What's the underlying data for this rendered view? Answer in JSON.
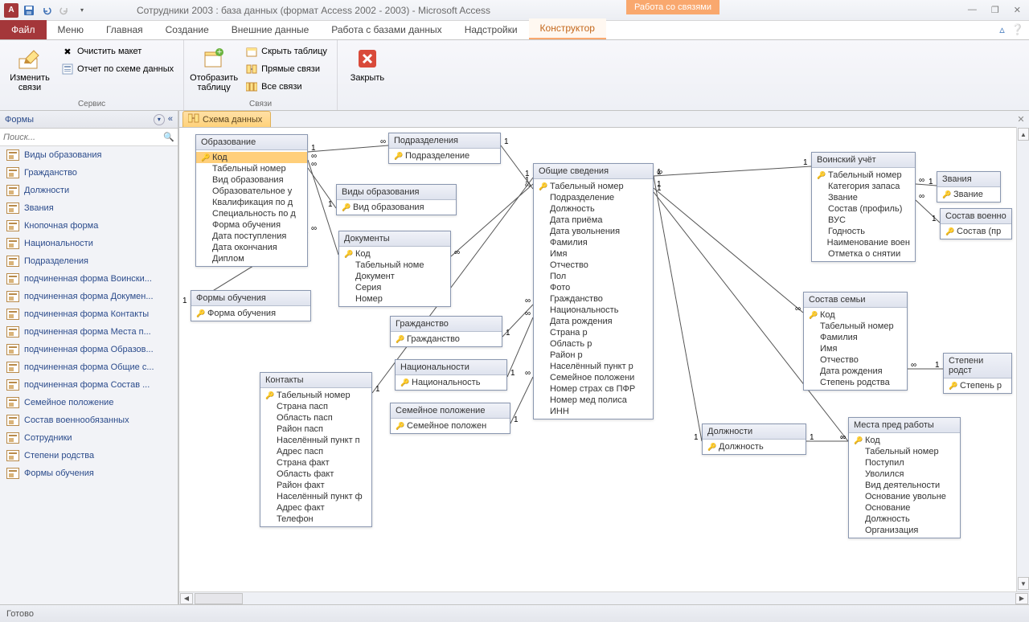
{
  "title": "Сотрудники 2003 : база данных (формат Access 2002 - 2003)  -  Microsoft Access",
  "context_tab_group": "Работа со связями",
  "ribbon_tabs": {
    "file": "Файл",
    "menu": "Меню",
    "home": "Главная",
    "create": "Создание",
    "external": "Внешние данные",
    "dbtools": "Работа с базами данных",
    "addins": "Надстройки",
    "design": "Конструктор"
  },
  "ribbon": {
    "edit_rel": "Изменить связи",
    "clear_layout": "Очистить макет",
    "rel_report": "Отчет по схеме данных",
    "group_service": "Сервис",
    "show_table": "Отобразить таблицу",
    "hide_table": "Скрыть таблицу",
    "direct_rel": "Прямые связи",
    "all_rel": "Все связи",
    "group_rel": "Связи",
    "close": "Закрыть"
  },
  "nav": {
    "header": "Формы",
    "search_placeholder": "Поиск...",
    "items": [
      "Виды образования",
      "Гражданство",
      "Должности",
      "Звания",
      "Кнопочная форма",
      "Национальности",
      "Подразделения",
      "подчиненная форма Воински...",
      "подчиненная форма Докумен...",
      "подчиненная форма Контакты",
      "подчиненная форма Места п...",
      "подчиненная форма Образов...",
      "подчиненная форма Общие с...",
      "подчиненная форма Состав ...",
      "Семейное положение",
      "Состав военнообязанных",
      "Сотрудники",
      "Степени родства",
      "Формы обучения"
    ]
  },
  "doc_tab": "Схема данных",
  "tables": {
    "education": {
      "title": "Образование",
      "fields": [
        "Код",
        "Табельный номер",
        "Вид образования",
        "Образовательное у",
        "Квалификация по д",
        "Специальность по д",
        "Форма обучения",
        "Дата поступления",
        "Дата окончания",
        "Диплом"
      ],
      "key": [
        0
      ]
    },
    "divisions": {
      "title": "Подразделения",
      "fields": [
        "Подразделение"
      ],
      "key": [
        0
      ]
    },
    "edu_types": {
      "title": "Виды образования",
      "fields": [
        "Вид образования"
      ],
      "key": [
        0
      ]
    },
    "documents": {
      "title": "Документы",
      "fields": [
        "Код",
        "Табельный номе",
        "Документ",
        "Серия",
        "Номер"
      ],
      "key": [
        0
      ]
    },
    "study_forms": {
      "title": "Формы обучения",
      "fields": [
        "Форма обучения"
      ],
      "key": [
        0
      ]
    },
    "citizenship": {
      "title": "Гражданство",
      "fields": [
        "Гражданство"
      ],
      "key": [
        0
      ]
    },
    "nationality": {
      "title": "Национальности",
      "fields": [
        "Национальность"
      ],
      "key": [
        0
      ]
    },
    "marital": {
      "title": "Семейное положение",
      "fields": [
        "Семейное положен"
      ],
      "key": [
        0
      ]
    },
    "contacts": {
      "title": "Контакты",
      "fields": [
        "Табельный номер",
        "Страна пасп",
        "Область пасп",
        "Район пасп",
        "Населённый пункт п",
        "Адрес пасп",
        "Страна факт",
        "Область факт",
        "Район факт",
        "Населённый пункт ф",
        "Адрес факт",
        "Телефон"
      ],
      "key": [
        0
      ]
    },
    "general": {
      "title": "Общие сведения",
      "fields": [
        "Табельный номер",
        "Подразделение",
        "Должность",
        "Дата приёма",
        "Дата увольнения",
        "Фамилия",
        "Имя",
        "Отчество",
        "Пол",
        "Фото",
        "Гражданство",
        "Национальность",
        "Дата рождения",
        "Страна р",
        "Область р",
        "Район р",
        "Населённый пункт р",
        "Семейное положени",
        "Номер страх св ПФР",
        "Номер мед полиса",
        "ИНН"
      ],
      "key": [
        0
      ]
    },
    "military": {
      "title": "Воинский учёт",
      "fields": [
        "Табельный номер",
        "Категория запаса",
        "Звание",
        "Состав (профиль)",
        "ВУС",
        "Годность",
        "Наименование воен",
        "Отметка о снятии"
      ],
      "key": [
        0
      ]
    },
    "ranks": {
      "title": "Звания",
      "fields": [
        "Звание"
      ],
      "key": [
        0
      ]
    },
    "mil_status": {
      "title": "Состав военно",
      "fields": [
        "Состав (пр"
      ],
      "key": [
        0
      ]
    },
    "positions": {
      "title": "Должности",
      "fields": [
        "Должность"
      ],
      "key": [
        0
      ]
    },
    "family": {
      "title": "Состав семьи",
      "fields": [
        "Код",
        "Табельный номер",
        "Фамилия",
        "Имя",
        "Отчество",
        "Дата рождения",
        "Степень родства"
      ],
      "key": [
        0
      ]
    },
    "kinship": {
      "title": "Степени родст",
      "fields": [
        "Степень р"
      ],
      "key": [
        0
      ]
    },
    "prev_jobs": {
      "title": "Места пред работы",
      "fields": [
        "Код",
        "Табельный номер",
        "Поступил",
        "Уволился",
        "Вид деятельности",
        "Основание увольне",
        "Основание",
        "Должность",
        "Организация"
      ],
      "key": [
        0
      ]
    }
  },
  "status": "Готово"
}
